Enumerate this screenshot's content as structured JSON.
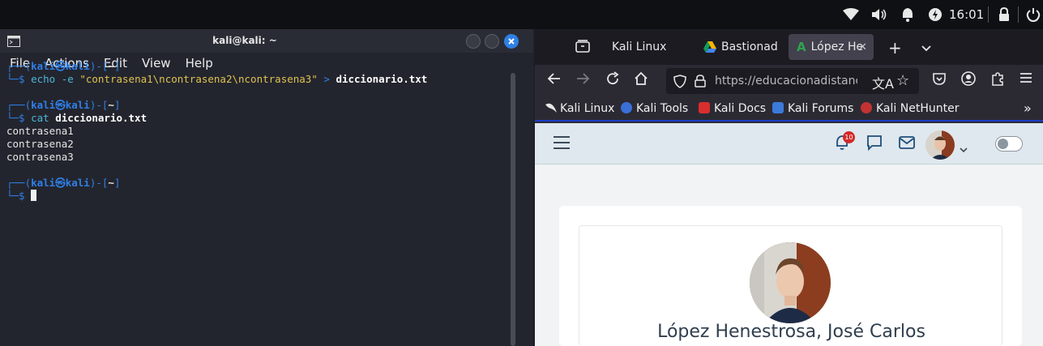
{
  "panel": {
    "clock": "16:01"
  },
  "terminal": {
    "title": "kali@kali: ~",
    "menu": [
      "File",
      "Actions",
      "Edit",
      "View",
      "Help"
    ],
    "prompt_user": "kali",
    "prompt_host": "kali",
    "prompt_dir": "~",
    "cmd1_prog": "echo",
    "cmd1_flag": "-e",
    "cmd1_string": "\"contrasena1\\ncontrasena2\\ncontrasena3\"",
    "cmd1_redirect": ">",
    "cmd1_file": "diccionario.txt",
    "cmd2_prog": "cat",
    "cmd2_file": "diccionario.txt",
    "output": [
      "contrasena1",
      "contrasena2",
      "contrasena3"
    ]
  },
  "browser": {
    "tabs": [
      {
        "label": "Kali Linux"
      },
      {
        "label": "Bastionad"
      },
      {
        "label": "López He"
      }
    ],
    "url": "https://educacionadistancia",
    "bookmarks": [
      "Kali Linux",
      "Kali Tools",
      "Kali Docs",
      "Kali Forums",
      "Kali NetHunter"
    ],
    "notification_count": "10",
    "profile_name": "López Henestrosa, José Carlos"
  },
  "colors": {
    "accent": "#2f7fe6",
    "string": "#e0c24f",
    "header": "#1f4e79",
    "badge": "#d12929"
  }
}
